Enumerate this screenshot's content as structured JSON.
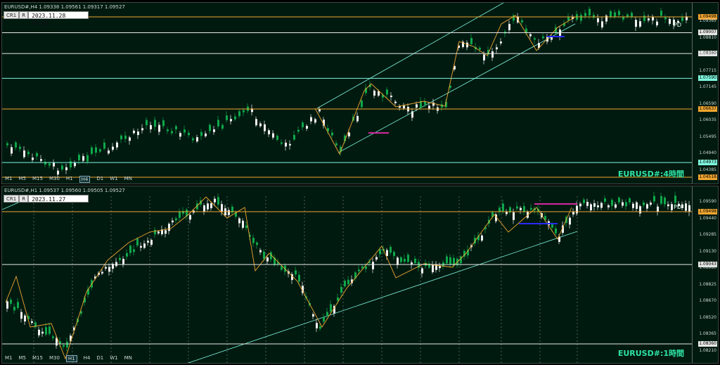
{
  "colors": {
    "bg": "#001a10",
    "orange": "#f0a530",
    "white": "#e6e6e6",
    "cyan": "#7ff5dd",
    "bull": "#0fa84a",
    "bear": "#f2f2f2",
    "magenta": "#d02aa0",
    "blue": "#2a2aff"
  },
  "panel1": {
    "symbol_info": "EURUSD#,H4  1.09338 1.09561 1.09317 1.09527",
    "btn_cr": "CR1",
    "btn_r": "R",
    "date": "2023.11.28 00:00",
    "pd": "PD",
    "title": "EURUSD#:4時間",
    "ticks": [
      "1.09365",
      "1.08810",
      "1.08255",
      "1.07715",
      "1.07145",
      "1.06590",
      "1.06035",
      "1.05495",
      "1.04940",
      "1.04385"
    ],
    "levels": [
      {
        "name": "level-1.09498",
        "value": 1.09498,
        "color": "orange",
        "text": "1.09498"
      },
      {
        "name": "level-1.09007",
        "value": 1.09007,
        "color": "white",
        "text": "1.09007"
      },
      {
        "name": "level-1.08360",
        "value": 1.0836,
        "color": "white",
        "text": "1.08360"
      },
      {
        "name": "level-1.07590",
        "value": 1.0759,
        "color": "cyan",
        "text": "1.07590"
      },
      {
        "name": "level-1.06637",
        "value": 1.06637,
        "color": "orange",
        "text": "1.06637"
      },
      {
        "name": "level-1.04973",
        "value": 1.04973,
        "color": "cyan",
        "text": "1.04973"
      },
      {
        "name": "level-1.04518",
        "value": 1.04518,
        "color": "orange",
        "text": "1.04518"
      }
    ],
    "timeframes": [
      "M1",
      "M5",
      "M15",
      "M30",
      "H1",
      "H4",
      "D1",
      "W1",
      "MN"
    ],
    "selected_tf": "H4"
  },
  "panel2": {
    "symbol_info": "EURUSD#,H1  1.09537 1.09560 1.09505 1.09527",
    "btn_cr": "CR1",
    "btn_r": "R",
    "date": "2023.11.27 23:00",
    "pd": "PD",
    "title": "EURUSD#:1時間",
    "ticks": [
      "1.09590",
      "1.09440",
      "1.09285",
      "1.09130",
      "1.08980",
      "1.08825",
      "1.08670",
      "1.08520",
      "1.08365",
      "1.08210"
    ],
    "levels": [
      {
        "name": "level-1.09498",
        "value": 1.09498,
        "color": "orange",
        "text": "1.09498"
      },
      {
        "name": "level-1.09043",
        "value": 1.09043,
        "color": "white",
        "text": "1.09043"
      },
      {
        "name": "level-1.08360",
        "value": 1.0836,
        "color": "white",
        "text": "1.08360"
      }
    ],
    "timeframes": [
      "M1",
      "M5",
      "M15",
      "M30",
      "H1",
      "H4",
      "D1",
      "W1",
      "MN"
    ],
    "selected_tf": "H1"
  }
}
